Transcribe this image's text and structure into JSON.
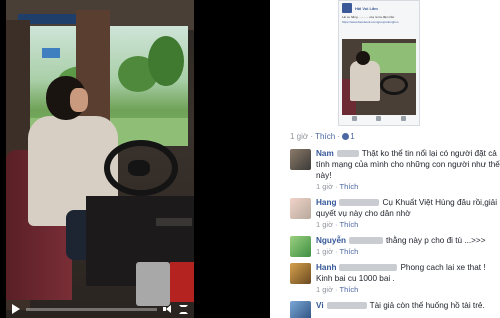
{
  "post": {
    "time": "1 giờ",
    "like_label": "Thích",
    "like_count": "1",
    "shared_preview": {
      "page_name": "Hải Vui Lắm",
      "text_line": "Lái xe hãng ............ xóa ra tra điện trắc",
      "link_text": "https://www.facebook.com/groups/tonghon"
    }
  },
  "comments": [
    {
      "author": "Nam",
      "text": "Thật ko thể tin nổi lại có người đặt cả tính mạng của mình cho những con người như thế này!",
      "time": "1 giờ",
      "like_label": "Thích"
    },
    {
      "author": "Hang",
      "text": "Cụ Khuất Việt Hùng đâu rồi,giải quyết vụ này cho dân nhờ",
      "time": "1 giờ",
      "like_label": "Thích"
    },
    {
      "author": "Nguyễn",
      "text": "thằng này p cho đi tù ...>>>",
      "time": "1 giờ",
      "like_label": "Thích"
    },
    {
      "author": "Hanh",
      "text": "Phong cach lai xe that ! Kinh bai cu 1000 bai .",
      "time": "1 giờ",
      "like_label": "Thích"
    },
    {
      "author": "Vi",
      "text": "Tài giả còn thế huống hồ tài trẻ.",
      "time": "",
      "like_label": ""
    }
  ],
  "video": {
    "progress": 0.0
  },
  "colors": {
    "link": "#365899",
    "meta": "#90949c"
  }
}
